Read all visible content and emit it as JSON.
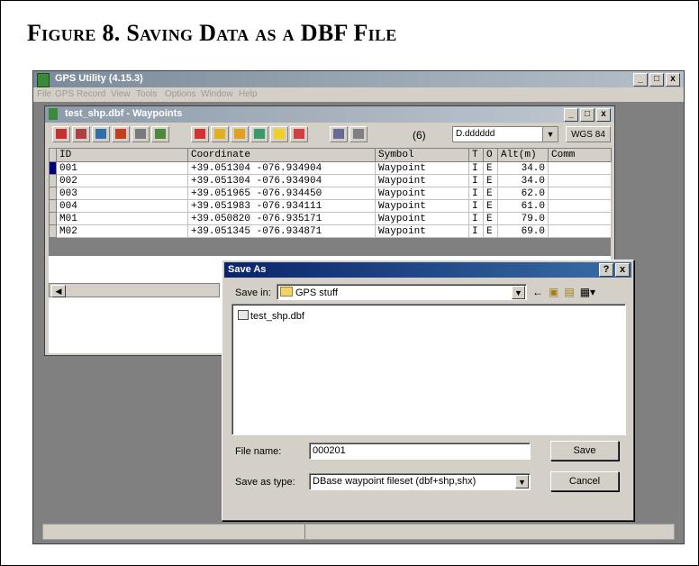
{
  "figure": {
    "title": "Figure 8. Saving Data as a DBF File"
  },
  "app": {
    "title": "GPS Utility (4.15.3)",
    "menu": [
      "File",
      "GPS",
      "Record",
      "View",
      "Tools",
      "Options",
      "Window",
      "Help"
    ],
    "window_buttons": [
      "_",
      "□",
      "x"
    ]
  },
  "child": {
    "title": "test_shp.dbf - Waypoints",
    "window_buttons": [
      "_",
      "□",
      "x"
    ],
    "toolbar": {
      "count": "(6)",
      "format": "D.dddddd",
      "datum": "WGS 84"
    },
    "columns": [
      "ID",
      "Coordinate",
      "Symbol",
      "T",
      "O",
      "Alt(m)",
      "Comm"
    ],
    "rows": [
      {
        "id": "001",
        "coord": "+39.051304 -076.934904",
        "symbol": "Waypoint",
        "t": "I",
        "o": "E",
        "alt": "34.0"
      },
      {
        "id": "002",
        "coord": "+39.051304 -076.934904",
        "symbol": "Waypoint",
        "t": "I",
        "o": "E",
        "alt": "34.0"
      },
      {
        "id": "003",
        "coord": "+39.051965 -076.934450",
        "symbol": "Waypoint",
        "t": "I",
        "o": "E",
        "alt": "62.0"
      },
      {
        "id": "004",
        "coord": "+39.051983 -076.934111",
        "symbol": "Waypoint",
        "t": "I",
        "o": "E",
        "alt": "61.0"
      },
      {
        "id": "M01",
        "coord": "+39.050820 -076.935171",
        "symbol": "Waypoint",
        "t": "I",
        "o": "E",
        "alt": "79.0"
      },
      {
        "id": "M02",
        "coord": "+39.051345 -076.934871",
        "symbol": "Waypoint",
        "t": "I",
        "o": "E",
        "alt": "69.0"
      }
    ]
  },
  "dialog": {
    "title": "Save As",
    "buttons": [
      "?",
      "x"
    ],
    "save_in_label": "Save in:",
    "save_in_value": "GPS stuff",
    "files": [
      "test_shp.dbf"
    ],
    "file_name_label": "File name:",
    "file_name_value": "000201",
    "save_type_label": "Save as type:",
    "save_type_value": "DBase waypoint fileset (dbf+shp,shx)",
    "save_button": "Save",
    "cancel_button": "Cancel"
  },
  "colors": {
    "title_active": "#0a246a",
    "title_inactive": "#8e9bab",
    "face": "#d4d0c8"
  }
}
